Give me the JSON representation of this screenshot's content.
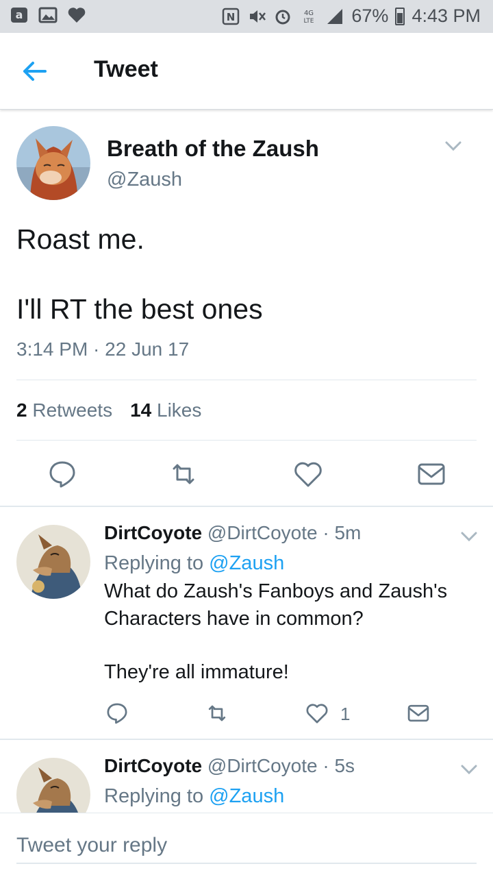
{
  "status_bar": {
    "battery": "67%",
    "time": "4:43 PM"
  },
  "header": {
    "title": "Tweet"
  },
  "main_tweet": {
    "display_name": "Breath of the Zaush",
    "handle": "@Zaush",
    "text_line1": "Roast me.",
    "text_line2": "I'll RT the best ones",
    "timestamp": "3:14 PM · 22 Jun 17",
    "retweets_count": "2",
    "retweets_label": "Retweets",
    "likes_count": "14",
    "likes_label": "Likes"
  },
  "replies": [
    {
      "display_name": "DirtCoyote",
      "handle": "@DirtCoyote",
      "time": "· 5m",
      "replying_label": "Replying to",
      "replying_handle": "@Zaush",
      "text_line1": "What do Zaush's Fanboys and Zaush's",
      "text_line2": "Characters have in common?",
      "text_line3": "They're all immature!",
      "likes": "1"
    },
    {
      "display_name": "DirtCoyote",
      "handle": "@DirtCoyote",
      "time": "· 5s",
      "replying_label": "Replying to",
      "replying_handle": "@Zaush"
    }
  ],
  "composer": {
    "placeholder": "Tweet your reply"
  },
  "colors": {
    "accent": "#1da1f2",
    "secondary_text": "#657786",
    "primary_text": "#14171a"
  }
}
